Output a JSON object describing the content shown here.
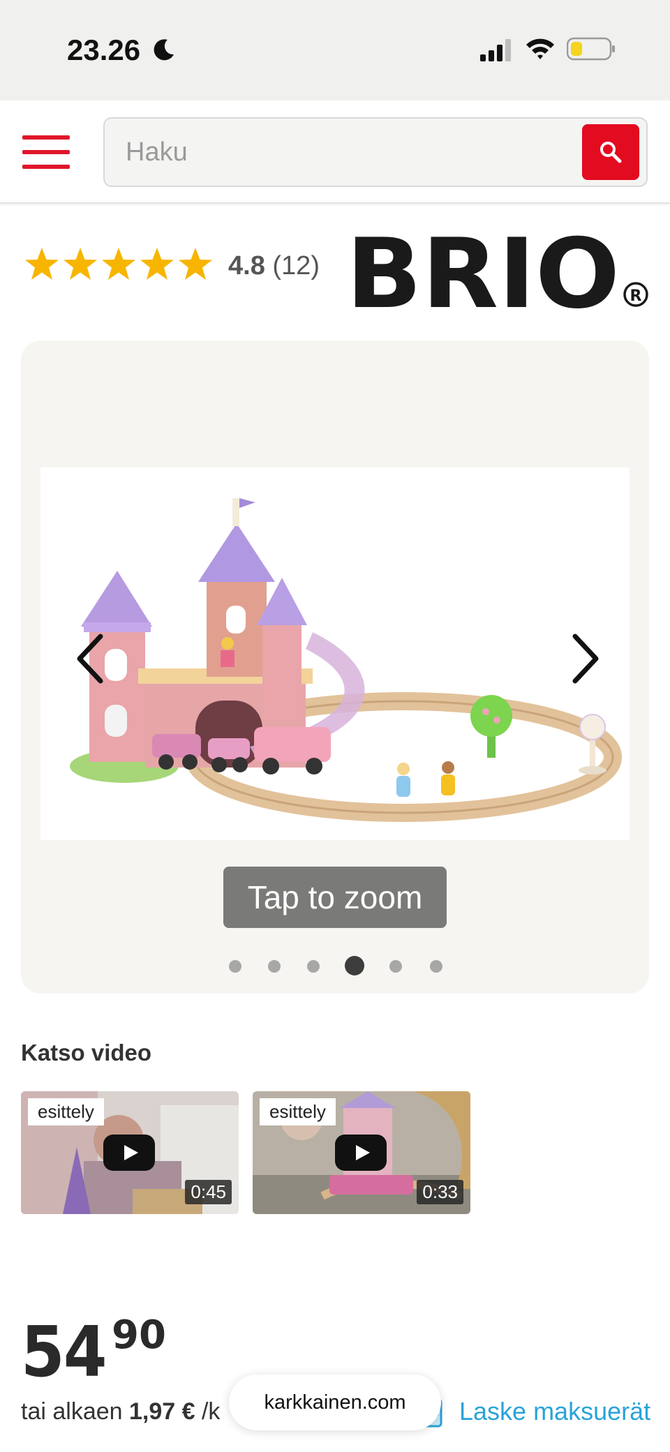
{
  "status_bar": {
    "time": "23.26"
  },
  "header": {
    "search_placeholder": "Haku"
  },
  "rating": {
    "score": "4.8",
    "count": "(12)",
    "stars": 5
  },
  "brand": {
    "name": "BRIO"
  },
  "gallery": {
    "zoom_label": "Tap to zoom",
    "total_images": 6,
    "active_index": 3
  },
  "videos": {
    "heading": "Katso video",
    "items": [
      {
        "label": "esittely",
        "duration": "0:45"
      },
      {
        "label": "esittely",
        "duration": "0:33"
      }
    ]
  },
  "price": {
    "main": "54",
    "cents": "90",
    "installment_prefix": "tai alkaen",
    "installment_amount": "1,97 €",
    "installment_suffix": "/k",
    "calc_link": "Laske maksuerät"
  },
  "browser": {
    "domain": "karkkainen.com"
  },
  "colors": {
    "accent_red": "#e30b1f",
    "star_yellow": "#f7b500",
    "link_blue": "#2aa3d8"
  }
}
